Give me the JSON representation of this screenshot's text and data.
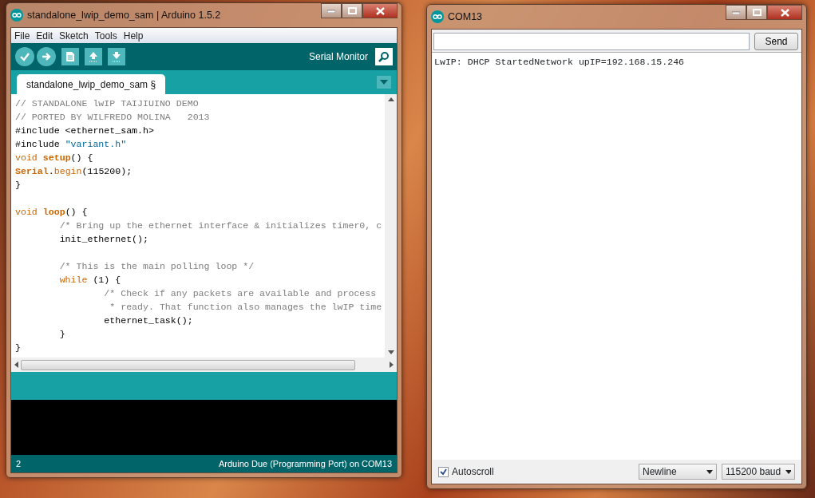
{
  "editor_window": {
    "title": "standalone_lwip_demo_sam | Arduino 1.5.2",
    "menu": [
      "File",
      "Edit",
      "Sketch",
      "Tools",
      "Help"
    ],
    "toolbar": {
      "serial_monitor_label": "Serial Monitor"
    },
    "tabs": [
      {
        "label": "standalone_lwip_demo_sam §",
        "selected": true
      }
    ],
    "code_lines": [
      {
        "kind": "code",
        "tokens": [
          {
            "kind": "comment",
            "text": "// STANDALONE lwIP TAIJIUINO DEMO"
          }
        ]
      },
      {
        "kind": "code",
        "tokens": [
          {
            "kind": "comment",
            "text": "// PORTED BY WILFREDO MOLINA   2013"
          }
        ]
      },
      {
        "kind": "code",
        "tokens": [
          {
            "kind": "plain",
            "text": "#include <ethernet_sam.h>"
          }
        ]
      },
      {
        "kind": "code",
        "tokens": [
          {
            "kind": "plain",
            "text": "#include "
          },
          {
            "kind": "string",
            "text": "\"variant.h\""
          }
        ]
      },
      {
        "kind": "code",
        "tokens": [
          {
            "kind": "keyword",
            "text": "void "
          },
          {
            "kind": "function",
            "text": "setup"
          },
          {
            "kind": "plain",
            "text": "() {"
          }
        ]
      },
      {
        "kind": "code",
        "tokens": [
          {
            "kind": "function",
            "text": "Serial"
          },
          {
            "kind": "plain",
            "text": "."
          },
          {
            "kind": "method",
            "text": "begin"
          },
          {
            "kind": "plain",
            "text": "(115200);"
          }
        ]
      },
      {
        "kind": "code",
        "tokens": [
          {
            "kind": "plain",
            "text": "}"
          }
        ]
      },
      {
        "kind": "blank"
      },
      {
        "kind": "code",
        "tokens": [
          {
            "kind": "keyword",
            "text": "void "
          },
          {
            "kind": "function",
            "text": "loop"
          },
          {
            "kind": "plain",
            "text": "() {"
          }
        ]
      },
      {
        "kind": "code",
        "tokens": [
          {
            "kind": "comment",
            "text": "        /* Bring up the ethernet interface & initializes timer0, c"
          }
        ]
      },
      {
        "kind": "code",
        "tokens": [
          {
            "kind": "plain",
            "text": "        init_ethernet();"
          }
        ]
      },
      {
        "kind": "blank"
      },
      {
        "kind": "code",
        "tokens": [
          {
            "kind": "comment",
            "text": "        /* This is the main polling loop */"
          }
        ]
      },
      {
        "kind": "code",
        "tokens": [
          {
            "kind": "keyword",
            "text": "        while"
          },
          {
            "kind": "plain",
            "text": " (1) {"
          }
        ]
      },
      {
        "kind": "code",
        "tokens": [
          {
            "kind": "comment",
            "text": "                /* Check if any packets are available and process"
          }
        ]
      },
      {
        "kind": "code",
        "tokens": [
          {
            "kind": "comment",
            "text": "                 * ready. That function also manages the lwIP time"
          }
        ]
      },
      {
        "kind": "code",
        "tokens": [
          {
            "kind": "plain",
            "text": "                ethernet_task();"
          }
        ]
      },
      {
        "kind": "code",
        "tokens": [
          {
            "kind": "plain",
            "text": "        }"
          }
        ]
      },
      {
        "kind": "code",
        "tokens": [
          {
            "kind": "plain",
            "text": "}"
          }
        ]
      }
    ],
    "status_bar": {
      "line": "2",
      "board": "Arduino Due (Programming Port) on COM13"
    }
  },
  "serial_window": {
    "title": "COM13",
    "send_button": "Send",
    "output": [
      "LwIP: DHCP StartedNetwork upIP=192.168.15.246"
    ],
    "autoscroll": {
      "label": "Autoscroll",
      "checked": true
    },
    "line_ending": "Newline",
    "baud": "115200 baud"
  }
}
